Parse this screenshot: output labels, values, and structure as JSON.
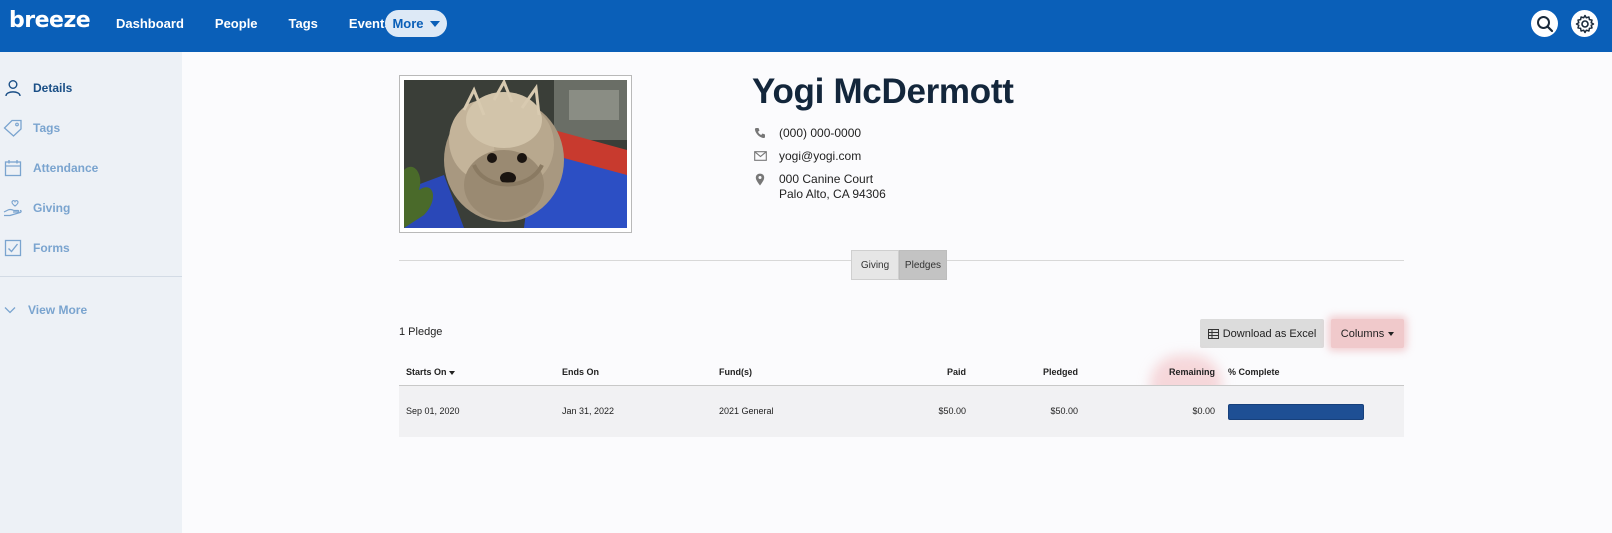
{
  "app": {
    "logo": "breeze",
    "nav": [
      "Dashboard",
      "People",
      "Tags",
      "Events"
    ],
    "more_label": "More"
  },
  "sidebar": {
    "items": [
      {
        "label": "Details",
        "icon": "person-icon",
        "active": true
      },
      {
        "label": "Tags",
        "icon": "tag-icon",
        "active": false
      },
      {
        "label": "Attendance",
        "icon": "calendar-icon",
        "active": false
      },
      {
        "label": "Giving",
        "icon": "hand-heart-icon",
        "active": false
      },
      {
        "label": "Forms",
        "icon": "checkbox-icon",
        "active": false
      }
    ],
    "view_more": "View More"
  },
  "profile": {
    "name": "Yogi McDermott",
    "phone": "(000) 000-0000",
    "email": "yogi@yogi.com",
    "address_line1": "000 Canine Court",
    "address_line2": "Palo Alto, CA 94306"
  },
  "tabs": [
    {
      "label": "Giving",
      "active": false
    },
    {
      "label": "Pledges",
      "active": true
    }
  ],
  "pledges": {
    "count_label": "1 Pledge",
    "download_label": "Download as Excel",
    "columns_label": "Columns",
    "headers": {
      "starts_on": "Starts On",
      "ends_on": "Ends On",
      "funds": "Fund(s)",
      "paid": "Paid",
      "pledged": "Pledged",
      "remaining": "Remaining",
      "complete": "% Complete"
    },
    "rows": [
      {
        "starts_on": "Sep 01, 2020",
        "ends_on": "Jan 31, 2022",
        "funds": "2021 General",
        "paid": "$50.00",
        "pledged": "$50.00",
        "remaining": "$0.00",
        "complete_fraction": 1.0
      }
    ]
  },
  "colors": {
    "topbar": "#0a5fb8",
    "sidebar": "#edf1f6",
    "progress": "#1e4f94",
    "highlight": "#f0c9cb"
  }
}
